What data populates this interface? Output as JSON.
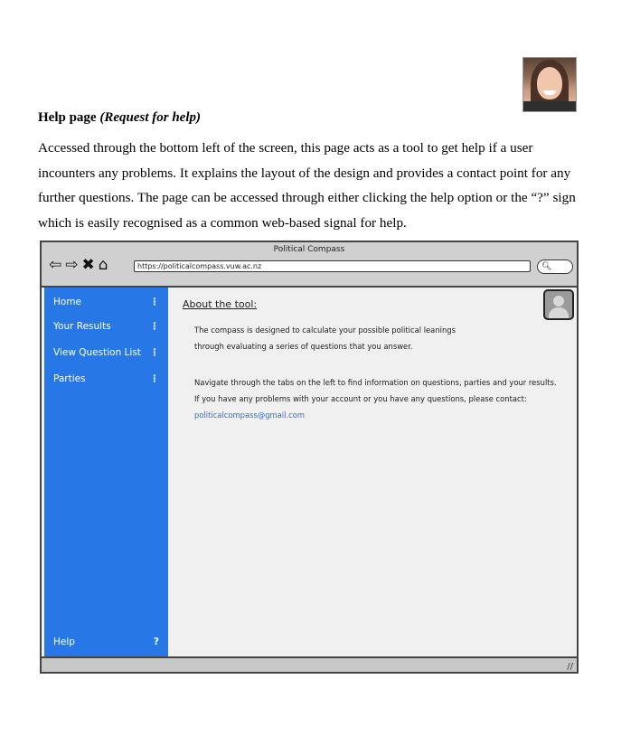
{
  "doc": {
    "heading": "Help page",
    "heading_sub": "(Request for help)",
    "paragraph": "Accessed through the bottom left of the screen, this page acts as a tool to get help if a user incounters any problems. It explains the layout of the design and provides a contact point for any further questions. The page can be accessed through either clicking the help option or the “?” sign which is easily recognised as a common web-based signal for help."
  },
  "mock": {
    "window_title": "Political Compass",
    "url": "https://politicalcompass.vuw.ac.nz",
    "icons": [
      "back-arrow-icon",
      "forward-arrow-icon",
      "close-icon",
      "home-icon",
      "search-icon",
      "user-avatar-icon"
    ],
    "sidebar": {
      "items": [
        {
          "label": "Home",
          "mark": "⋮"
        },
        {
          "label": "Your Results",
          "mark": "⋮"
        },
        {
          "label": "View Question List",
          "mark": "⋮"
        },
        {
          "label": "Parties",
          "mark": "⋮"
        }
      ],
      "help": {
        "label": "Help",
        "mark": "?"
      }
    },
    "content": {
      "title": "About the tool:",
      "lines": [
        "The compass is designed to calculate your possible political leanings",
        "through evaluating a series of questions that you answer.",
        "Navigate through the tabs on the left to find information on questions, parties and your results.",
        "If you have any problems with your account or you have any questions, please contact:"
      ],
      "email": "politicalcompass@gmail.com"
    },
    "colors": {
      "sidebar": "#2778e6",
      "link": "#2a6fd6",
      "window": "#f0f0f0"
    }
  }
}
